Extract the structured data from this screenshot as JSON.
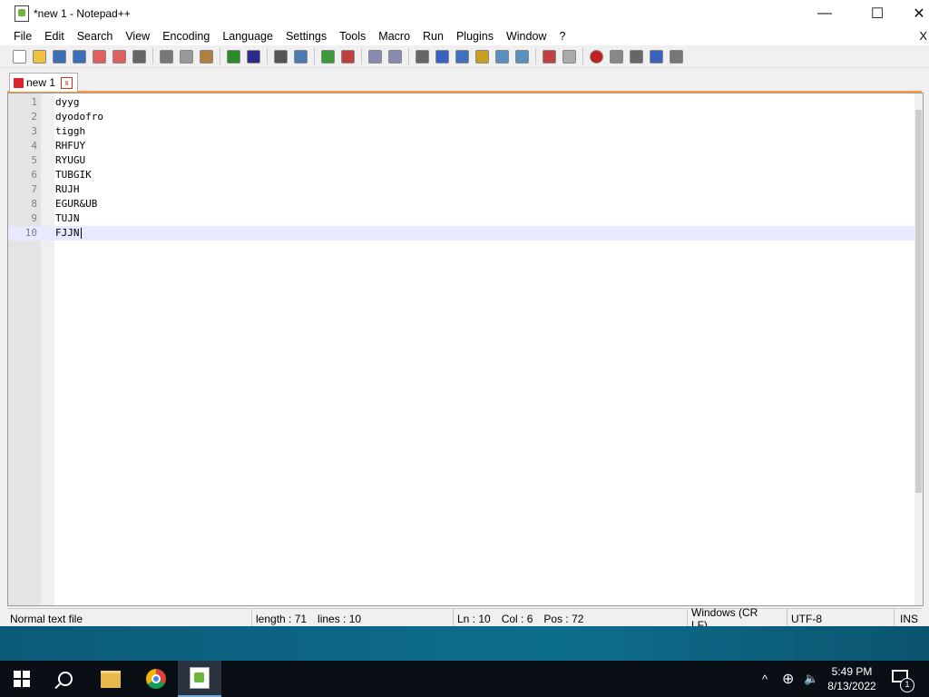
{
  "window": {
    "title": "*new 1 - Notepad++",
    "minimize_glyph": "—",
    "maximize_glyph": "☐",
    "close_glyph": "✕"
  },
  "menu": {
    "items": [
      "File",
      "Edit",
      "Search",
      "View",
      "Encoding",
      "Language",
      "Settings",
      "Tools",
      "Macro",
      "Run",
      "Plugins",
      "Window",
      "?"
    ],
    "close_glyph": "X"
  },
  "toolbar": {
    "icons": [
      "new-file-icon",
      "open-file-icon",
      "save-icon",
      "save-all-icon",
      "close-icon",
      "close-all-icon",
      "print-icon",
      "cut-icon",
      "copy-icon",
      "paste-icon",
      "undo-icon",
      "redo-icon",
      "find-icon",
      "replace-icon",
      "zoom-in-icon",
      "zoom-out-icon",
      "sync-vertical-icon",
      "sync-horizontal-icon",
      "word-wrap-icon",
      "show-all-chars-icon",
      "indent-guide-icon",
      "user-language-icon",
      "doc-map-icon",
      "function-list-icon",
      "folder-workspace-icon",
      "monitoring-icon",
      "record-macro-icon",
      "stop-record-icon",
      "play-macro-icon",
      "run-macro-multiple-icon",
      "save-macro-icon"
    ]
  },
  "tab": {
    "label": "new 1",
    "close_glyph": "x"
  },
  "editor": {
    "lines": [
      {
        "n": "1",
        "text": "dyyg"
      },
      {
        "n": "2",
        "text": "dyodofro"
      },
      {
        "n": "3",
        "text": "tiggh"
      },
      {
        "n": "4",
        "text": "RHFUY"
      },
      {
        "n": "5",
        "text": "RYUGU"
      },
      {
        "n": "6",
        "text": "TUBGIK"
      },
      {
        "n": "7",
        "text": "RUJH"
      },
      {
        "n": "8",
        "text": "EGUR&UB"
      },
      {
        "n": "9",
        "text": "TUJN"
      },
      {
        "n": "10",
        "text": "FJJN"
      }
    ],
    "current_line": "10"
  },
  "status": {
    "file_type": "Normal text file",
    "length": "length : 71",
    "lines": "lines : 10",
    "ln": "Ln : 10",
    "col": "Col : 6",
    "pos": "Pos : 72",
    "eol": "Windows (CR LF)",
    "encoding": "UTF-8",
    "mode": "INS"
  },
  "taskbar": {
    "time": "5:49 PM",
    "date": "8/13/2022",
    "notification_count": "1",
    "tray_chevron": "^",
    "network_glyph": "⊕",
    "volume_glyph": "🔈"
  }
}
